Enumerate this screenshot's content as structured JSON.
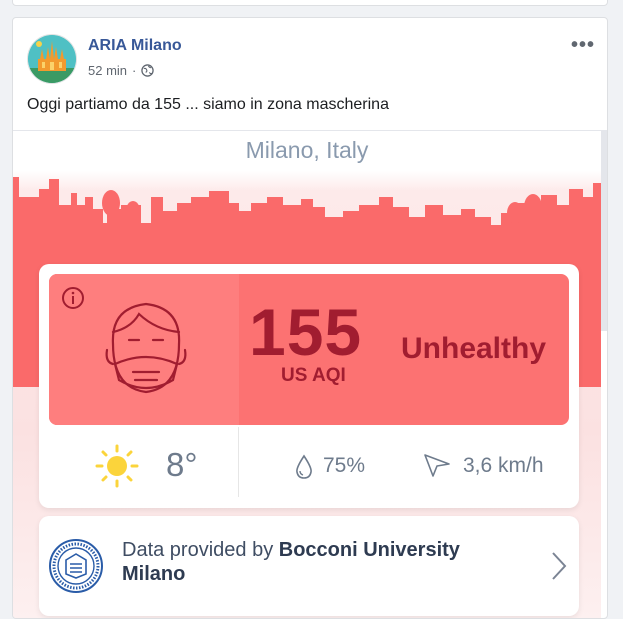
{
  "post": {
    "page_name": "ARIA Milano",
    "time": "52 min",
    "separator": "·",
    "more": "•••",
    "text": "Oggi partiamo da 155 ... siamo in zona mascherina"
  },
  "widget": {
    "city": "Milano, Italy",
    "aqi_value": "155",
    "aqi_unit": "US AQI",
    "aqi_status": "Unhealthy",
    "temperature": "8°",
    "humidity": "75%",
    "wind": "3,6 km/h",
    "provider_prefix": "Data provided by ",
    "provider_name": "Bocconi University Milano",
    "colors": {
      "aqi_panel": "#fc7272",
      "aqi_text": "#a11d30",
      "skyline": "#fa6a6a"
    }
  }
}
